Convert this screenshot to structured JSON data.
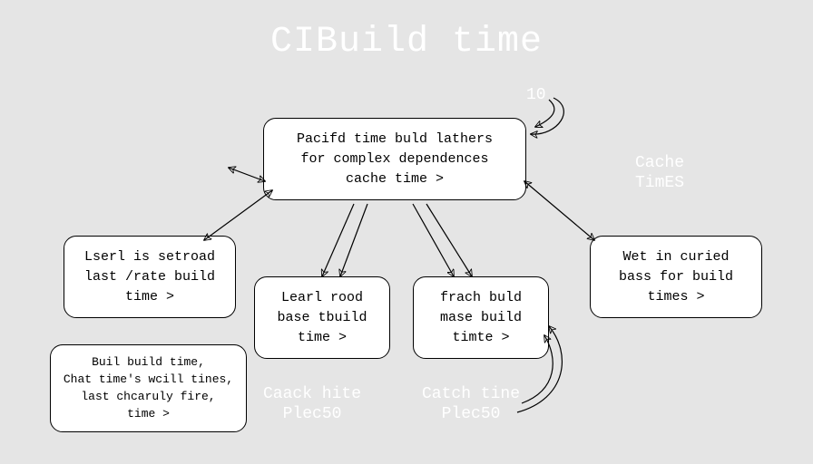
{
  "title": "CIBuild time",
  "labels": {
    "topNumber": "10",
    "cacheTimes1": "Cache",
    "cacheTimes2": "TimES",
    "caackHite1": "Caack hite",
    "caackHite2": "Plec50",
    "catchTine1": "Catch tine",
    "catchTine2": "Plec50"
  },
  "nodes": {
    "central": {
      "l1": "Pacifd time buld lathers",
      "l2": "for complex dependences",
      "l3": "cache time >"
    },
    "leftUpper": {
      "l1": "Lserl is setroad",
      "l2": "last /rate build",
      "l3": "time >"
    },
    "mid1": {
      "l1": "Learl rood",
      "l2": "base tbuild",
      "l3": "time >"
    },
    "mid2": {
      "l1": "frach buld",
      "l2": "mase build",
      "l3": "timte >"
    },
    "right": {
      "l1": "Wet in curied",
      "l2": "bass for build",
      "l3": "times >"
    },
    "leftLower": {
      "l1": "Buil build time,",
      "l2": "Chat time's wcill tines,",
      "l3": "last chcaruly fire,",
      "l4": "time >"
    }
  }
}
